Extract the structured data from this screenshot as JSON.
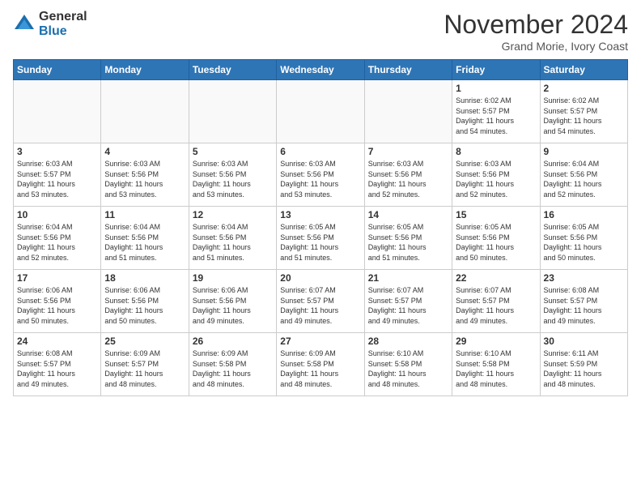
{
  "header": {
    "logo_general": "General",
    "logo_blue": "Blue",
    "month_title": "November 2024",
    "location": "Grand Morie, Ivory Coast"
  },
  "weekdays": [
    "Sunday",
    "Monday",
    "Tuesday",
    "Wednesday",
    "Thursday",
    "Friday",
    "Saturday"
  ],
  "weeks": [
    [
      {
        "day": "",
        "info": ""
      },
      {
        "day": "",
        "info": ""
      },
      {
        "day": "",
        "info": ""
      },
      {
        "day": "",
        "info": ""
      },
      {
        "day": "",
        "info": ""
      },
      {
        "day": "1",
        "info": "Sunrise: 6:02 AM\nSunset: 5:57 PM\nDaylight: 11 hours\nand 54 minutes."
      },
      {
        "day": "2",
        "info": "Sunrise: 6:02 AM\nSunset: 5:57 PM\nDaylight: 11 hours\nand 54 minutes."
      }
    ],
    [
      {
        "day": "3",
        "info": "Sunrise: 6:03 AM\nSunset: 5:57 PM\nDaylight: 11 hours\nand 53 minutes."
      },
      {
        "day": "4",
        "info": "Sunrise: 6:03 AM\nSunset: 5:56 PM\nDaylight: 11 hours\nand 53 minutes."
      },
      {
        "day": "5",
        "info": "Sunrise: 6:03 AM\nSunset: 5:56 PM\nDaylight: 11 hours\nand 53 minutes."
      },
      {
        "day": "6",
        "info": "Sunrise: 6:03 AM\nSunset: 5:56 PM\nDaylight: 11 hours\nand 53 minutes."
      },
      {
        "day": "7",
        "info": "Sunrise: 6:03 AM\nSunset: 5:56 PM\nDaylight: 11 hours\nand 52 minutes."
      },
      {
        "day": "8",
        "info": "Sunrise: 6:03 AM\nSunset: 5:56 PM\nDaylight: 11 hours\nand 52 minutes."
      },
      {
        "day": "9",
        "info": "Sunrise: 6:04 AM\nSunset: 5:56 PM\nDaylight: 11 hours\nand 52 minutes."
      }
    ],
    [
      {
        "day": "10",
        "info": "Sunrise: 6:04 AM\nSunset: 5:56 PM\nDaylight: 11 hours\nand 52 minutes."
      },
      {
        "day": "11",
        "info": "Sunrise: 6:04 AM\nSunset: 5:56 PM\nDaylight: 11 hours\nand 51 minutes."
      },
      {
        "day": "12",
        "info": "Sunrise: 6:04 AM\nSunset: 5:56 PM\nDaylight: 11 hours\nand 51 minutes."
      },
      {
        "day": "13",
        "info": "Sunrise: 6:05 AM\nSunset: 5:56 PM\nDaylight: 11 hours\nand 51 minutes."
      },
      {
        "day": "14",
        "info": "Sunrise: 6:05 AM\nSunset: 5:56 PM\nDaylight: 11 hours\nand 51 minutes."
      },
      {
        "day": "15",
        "info": "Sunrise: 6:05 AM\nSunset: 5:56 PM\nDaylight: 11 hours\nand 50 minutes."
      },
      {
        "day": "16",
        "info": "Sunrise: 6:05 AM\nSunset: 5:56 PM\nDaylight: 11 hours\nand 50 minutes."
      }
    ],
    [
      {
        "day": "17",
        "info": "Sunrise: 6:06 AM\nSunset: 5:56 PM\nDaylight: 11 hours\nand 50 minutes."
      },
      {
        "day": "18",
        "info": "Sunrise: 6:06 AM\nSunset: 5:56 PM\nDaylight: 11 hours\nand 50 minutes."
      },
      {
        "day": "19",
        "info": "Sunrise: 6:06 AM\nSunset: 5:56 PM\nDaylight: 11 hours\nand 49 minutes."
      },
      {
        "day": "20",
        "info": "Sunrise: 6:07 AM\nSunset: 5:57 PM\nDaylight: 11 hours\nand 49 minutes."
      },
      {
        "day": "21",
        "info": "Sunrise: 6:07 AM\nSunset: 5:57 PM\nDaylight: 11 hours\nand 49 minutes."
      },
      {
        "day": "22",
        "info": "Sunrise: 6:07 AM\nSunset: 5:57 PM\nDaylight: 11 hours\nand 49 minutes."
      },
      {
        "day": "23",
        "info": "Sunrise: 6:08 AM\nSunset: 5:57 PM\nDaylight: 11 hours\nand 49 minutes."
      }
    ],
    [
      {
        "day": "24",
        "info": "Sunrise: 6:08 AM\nSunset: 5:57 PM\nDaylight: 11 hours\nand 49 minutes."
      },
      {
        "day": "25",
        "info": "Sunrise: 6:09 AM\nSunset: 5:57 PM\nDaylight: 11 hours\nand 48 minutes."
      },
      {
        "day": "26",
        "info": "Sunrise: 6:09 AM\nSunset: 5:58 PM\nDaylight: 11 hours\nand 48 minutes."
      },
      {
        "day": "27",
        "info": "Sunrise: 6:09 AM\nSunset: 5:58 PM\nDaylight: 11 hours\nand 48 minutes."
      },
      {
        "day": "28",
        "info": "Sunrise: 6:10 AM\nSunset: 5:58 PM\nDaylight: 11 hours\nand 48 minutes."
      },
      {
        "day": "29",
        "info": "Sunrise: 6:10 AM\nSunset: 5:58 PM\nDaylight: 11 hours\nand 48 minutes."
      },
      {
        "day": "30",
        "info": "Sunrise: 6:11 AM\nSunset: 5:59 PM\nDaylight: 11 hours\nand 48 minutes."
      }
    ]
  ]
}
